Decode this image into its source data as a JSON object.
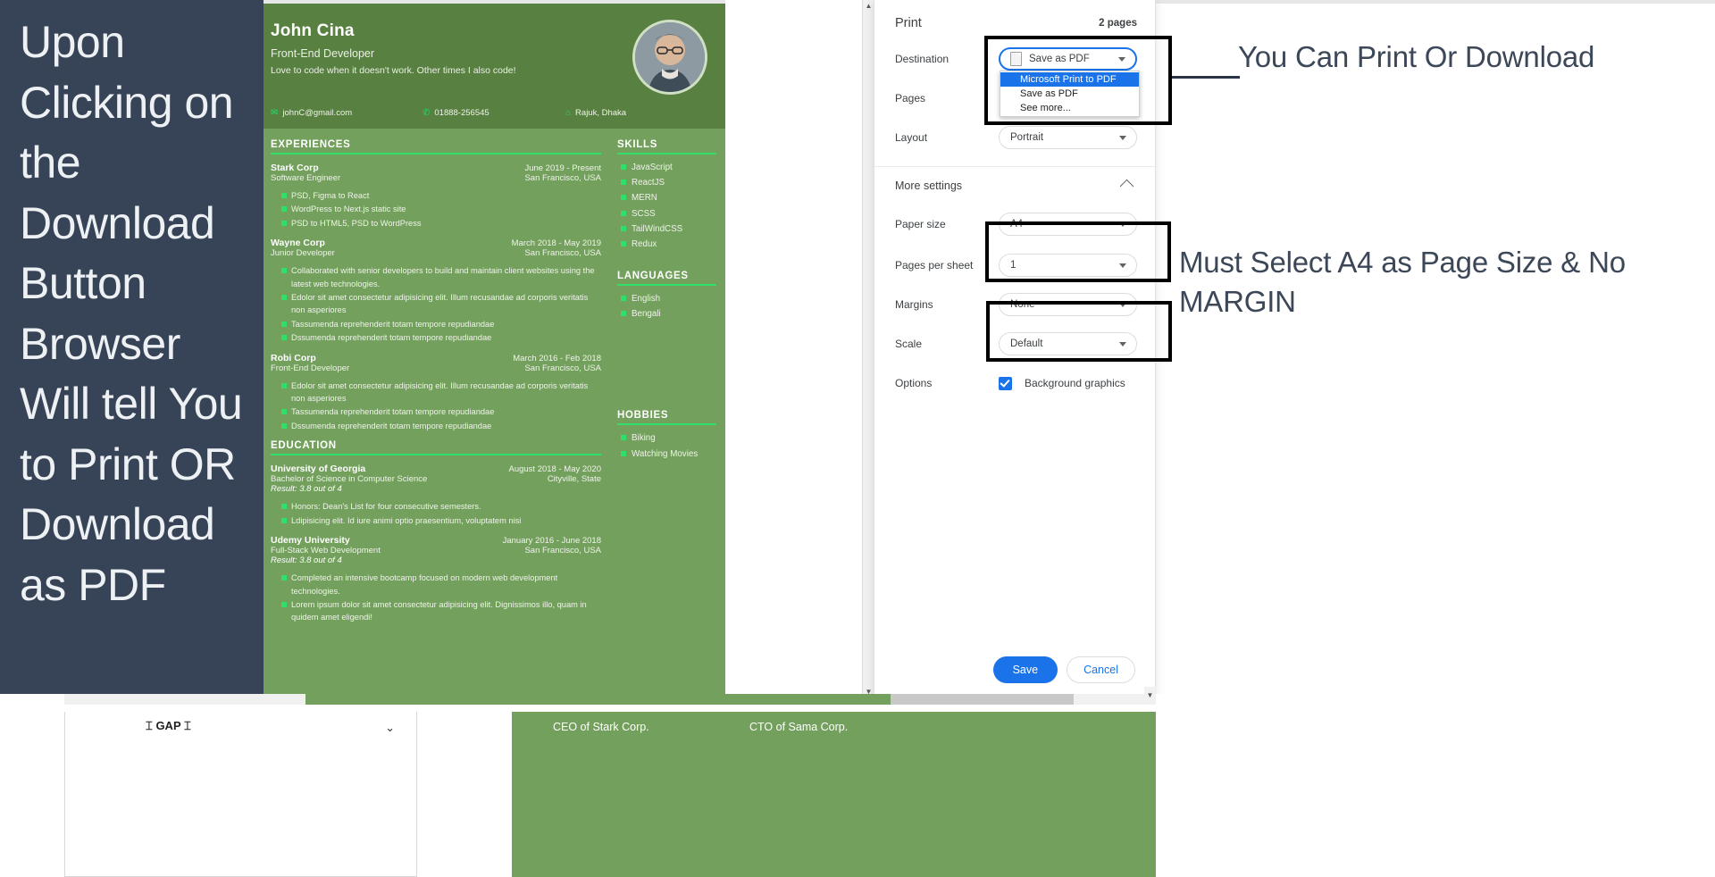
{
  "left_annotation": "Upon Clicking on the Download Button Browser Will tell You to Print OR Download as PDF",
  "right_annotation_1": "You Can Print Or Download",
  "right_annotation_2": "Must Select A4 as Page Size & No MARGIN",
  "resume": {
    "name": "John Cina",
    "role": "Front-End Developer",
    "tagline": "Love to code when it doesn't work. Other times I also code!",
    "email": "johnC@gmail.com",
    "phone": "01888-256545",
    "location": "Rajuk, Dhaka",
    "sections": {
      "experiences_title": "EXPERIENCES",
      "education_title": "EDUCATION",
      "skills_title": "SKILLS",
      "languages_title": "LANGUAGES",
      "hobbies_title": "HOBBIES"
    },
    "experiences": [
      {
        "org": "Stark Corp",
        "role": "Software Engineer",
        "date": "June 2019 - Present",
        "location": "San Francisco, USA",
        "bullets": [
          "PSD, Figma to React",
          "WordPress to Next.js static site",
          "PSD to HTML5, PSD to WordPress"
        ]
      },
      {
        "org": "Wayne Corp",
        "role": "Junior Developer",
        "date": "March 2018 - May 2019",
        "location": "San Francisco, USA",
        "bullets": [
          "Collaborated with senior developers to build and maintain client websites using the latest web technologies.",
          "Edolor sit amet consectetur adipisicing elit. Illum recusandae ad corporis veritatis non asperiores",
          "Tassumenda reprehenderit totam tempore repudiandae",
          "Dssumenda reprehenderit totam tempore repudiandae"
        ]
      },
      {
        "org": "Robi Corp",
        "role": "Front-End Developer",
        "date": "March 2016 - Feb 2018",
        "location": "San Francisco, USA",
        "bullets": [
          "Edolor sit amet consectetur adipisicing elit. Illum recusandae ad corporis veritatis non asperiores",
          "Tassumenda reprehenderit totam tempore repudiandae",
          "Dssumenda reprehenderit totam tempore repudiandae"
        ]
      }
    ],
    "education": [
      {
        "org": "University of Georgia",
        "role": "Bachelor of Science in Computer Science",
        "result": "Result: 3.8 out of 4",
        "date": "August 2018 - May 2020",
        "location": "Cityville, State",
        "bullets": [
          "Honors: Dean's List for four consecutive semesters.",
          "Ldipisicing elit. Id iure animi optio praesentium, voluptatem nisi"
        ]
      },
      {
        "org": "Udemy University",
        "role": "Full-Stack Web Development",
        "result": "Result: 3.8 out of 4",
        "date": "January 2016 - June 2018",
        "location": "San Francisco, USA",
        "bullets": [
          "Completed an intensive bootcamp focused on modern web development technologies.",
          "Lorem ipsum dolor sit amet consectetur adipisicing elit. Dignissimos illo, quam in quidem amet eligendi!"
        ]
      }
    ],
    "skills": [
      "JavaScript",
      "ReactJS",
      "MERN",
      "SCSS",
      "TailWindCSS",
      "Redux"
    ],
    "languages": [
      "English",
      "Bengali"
    ],
    "hobbies": [
      "Biking",
      "Watching Movies"
    ]
  },
  "print_dialog": {
    "title": "Print",
    "pages_count": "2 pages",
    "labels": {
      "destination": "Destination",
      "pages": "Pages",
      "layout": "Layout",
      "more_settings": "More settings",
      "paper_size": "Paper size",
      "pages_per_sheet": "Pages per sheet",
      "margins": "Margins",
      "scale": "Scale",
      "options": "Options"
    },
    "values": {
      "destination": "Save as PDF",
      "layout": "Portrait",
      "paper_size": "A4",
      "pages_per_sheet": "1",
      "margins": "None",
      "scale": "Default"
    },
    "destination_options": [
      "Microsoft Print to PDF",
      "Save as PDF",
      "See more..."
    ],
    "destination_selected": "Microsoft Print to PDF",
    "background_graphics_label": "Background graphics",
    "save_label": "Save",
    "cancel_label": "Cancel",
    "accent_color": "#1a73e8"
  },
  "bottom_bar": {
    "gap_label": "GAP",
    "green_text_1": "CEO of Stark Corp.",
    "green_text_2": "CTO of Sama Corp."
  }
}
